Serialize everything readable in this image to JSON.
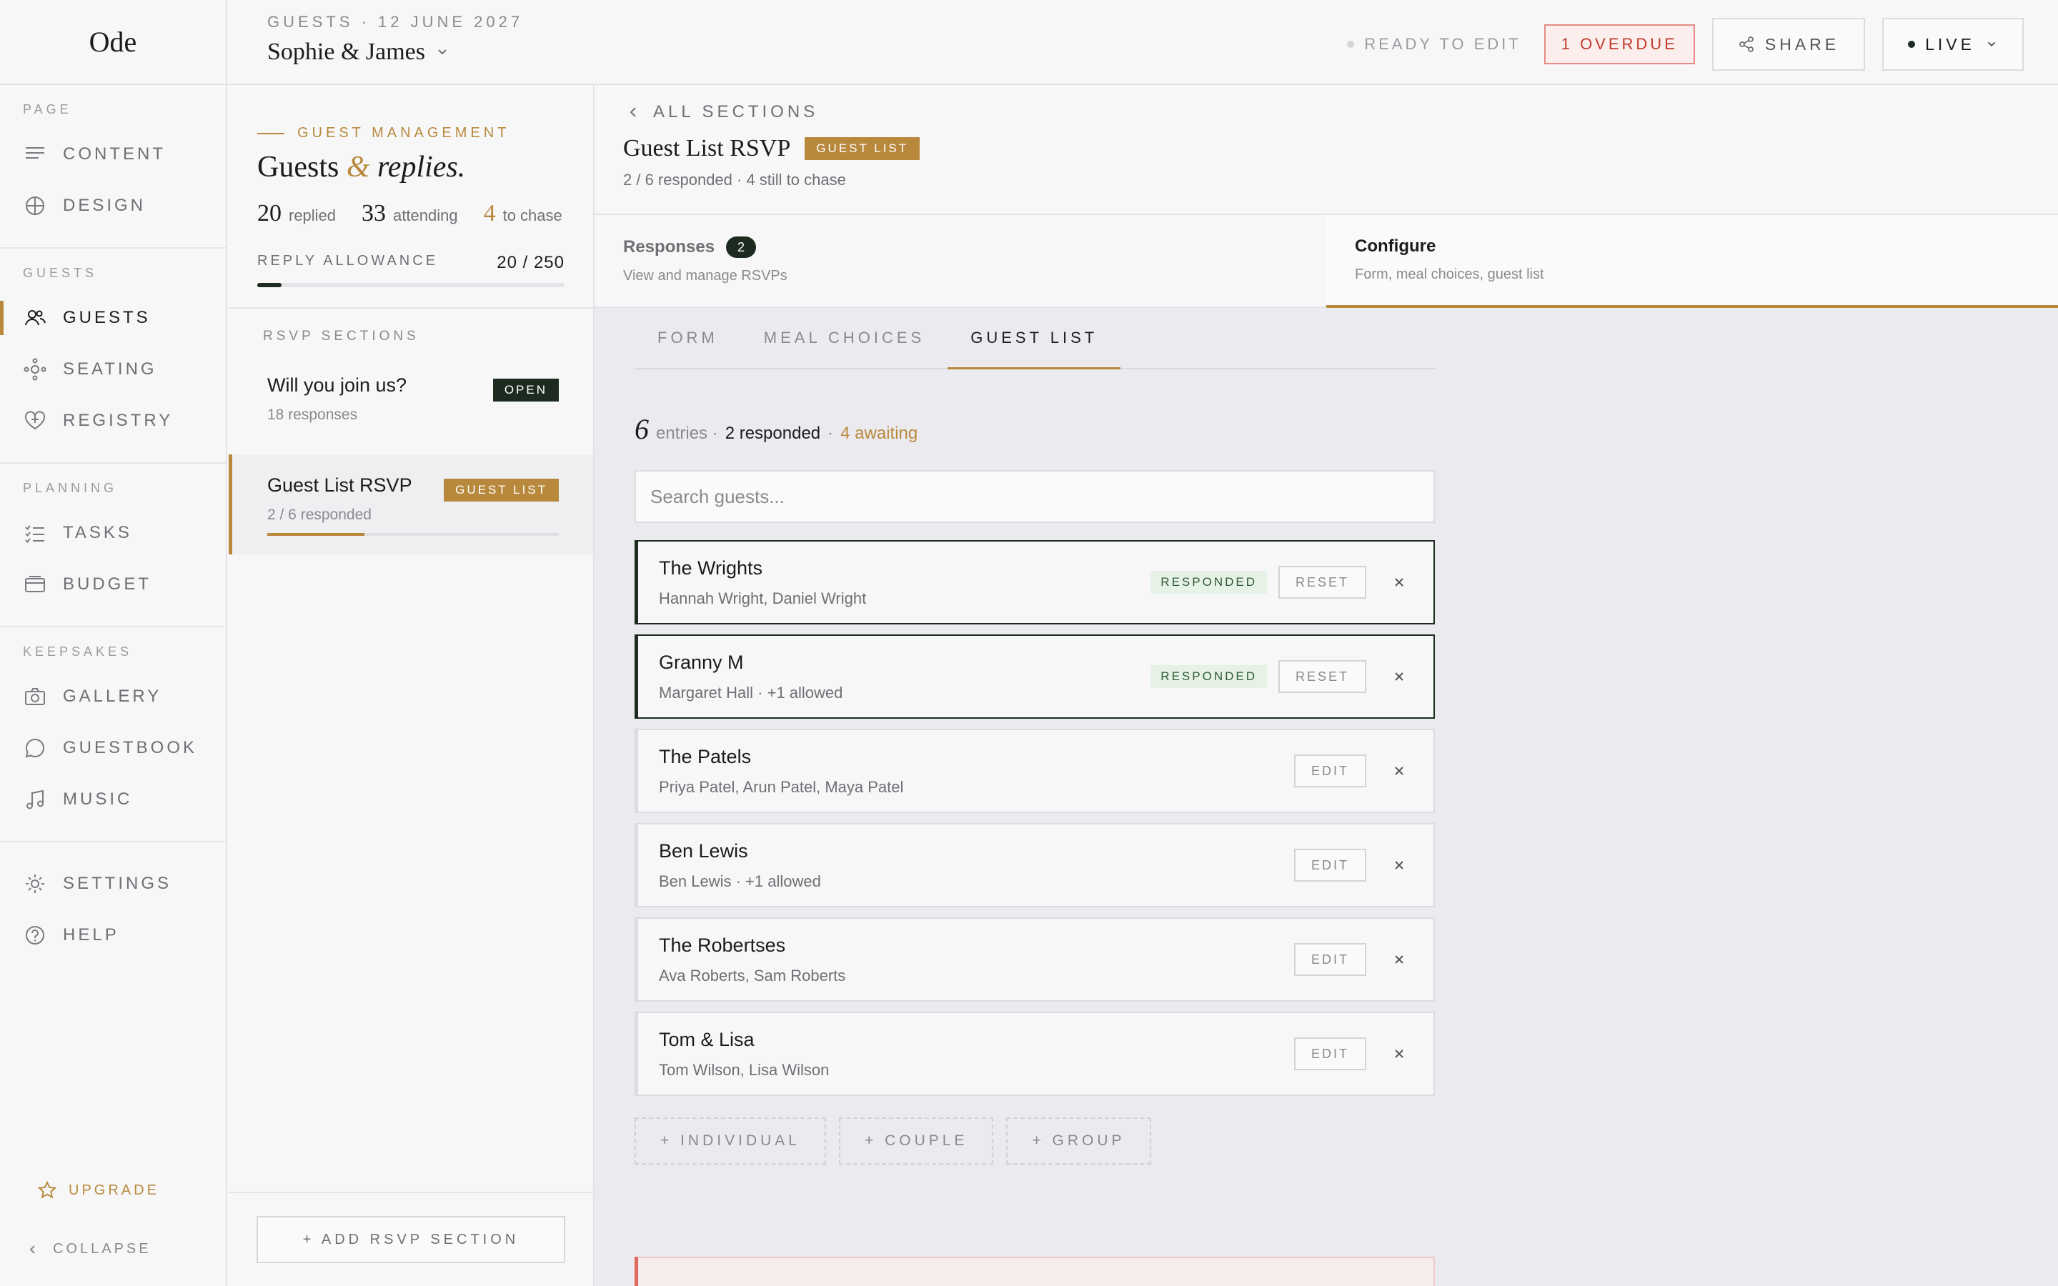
{
  "app": {
    "logo": "Ode"
  },
  "header": {
    "event_line": "GUESTS · 12 JUNE 2027",
    "couple_name": "Sophie & James",
    "status_label": "READY TO EDIT",
    "overdue_label": "1 OVERDUE",
    "share_label": "SHARE",
    "live_label": "LIVE"
  },
  "nav": {
    "sections": [
      {
        "title": "PAGE",
        "items": [
          {
            "label": "CONTENT",
            "icon": "lines-icon"
          },
          {
            "label": "DESIGN",
            "icon": "globe-icon"
          }
        ]
      },
      {
        "title": "GUESTS",
        "items": [
          {
            "label": "GUESTS",
            "icon": "people-icon",
            "active": true
          },
          {
            "label": "SEATING",
            "icon": "seating-icon"
          },
          {
            "label": "REGISTRY",
            "icon": "heart-icon"
          }
        ]
      },
      {
        "title": "PLANNING",
        "items": [
          {
            "label": "TASKS",
            "icon": "checklist-icon"
          },
          {
            "label": "BUDGET",
            "icon": "wallet-icon"
          }
        ]
      },
      {
        "title": "KEEPSAKES",
        "items": [
          {
            "label": "GALLERY",
            "icon": "camera-icon"
          },
          {
            "label": "GUESTBOOK",
            "icon": "chat-icon"
          },
          {
            "label": "MUSIC",
            "icon": "music-icon"
          }
        ]
      }
    ],
    "bottom_items": [
      {
        "label": "SETTINGS",
        "icon": "sun-icon"
      },
      {
        "label": "HELP",
        "icon": "help-icon"
      }
    ],
    "upgrade_label": "UPGRADE",
    "collapse_label": "COLLAPSE"
  },
  "panel": {
    "eyebrow": "GUEST MANAGEMENT",
    "title_part1": "Guests",
    "title_amp": "&",
    "title_part2": "replies.",
    "stats": [
      {
        "value": "20",
        "label": "replied",
        "accent": false
      },
      {
        "value": "33",
        "label": "attending",
        "accent": false
      },
      {
        "value": "4",
        "label": "to chase",
        "accent": true
      }
    ],
    "allowance_label": "REPLY ALLOWANCE",
    "allowance_value": "20 / 250",
    "allowance_fraction": 0.08,
    "rsvp_sections_title": "RSVP SECTIONS",
    "rsvp_sections": [
      {
        "name": "Will you join us?",
        "sub": "18 responses",
        "tag": "OPEN",
        "active": false
      },
      {
        "name": "Guest List RSVP",
        "sub": "2 / 6 responded",
        "tag": "GUEST LIST",
        "active": true,
        "progress": 0.333
      }
    ],
    "add_section_label": "+ ADD RSVP SECTION"
  },
  "main": {
    "back_label": "ALL SECTIONS",
    "title": "Guest List RSVP",
    "title_tag": "GUEST LIST",
    "subtitle": "2 / 6 responded · 4 still to chase",
    "tabs": [
      {
        "label": "Responses",
        "count": "2",
        "desc": "View and manage RSVPs",
        "active": false
      },
      {
        "label": "Configure",
        "desc": "Form, meal choices, guest list",
        "active": true
      }
    ],
    "subtabs": [
      {
        "label": "FORM",
        "active": false
      },
      {
        "label": "MEAL CHOICES",
        "active": false
      },
      {
        "label": "GUEST LIST",
        "active": true
      }
    ],
    "summary": {
      "count": "6",
      "entries": "entries ·",
      "responded": "2 responded",
      "sep": "·",
      "awaiting": "4 awaiting"
    },
    "search_placeholder": "Search guests...",
    "guests": [
      {
        "name": "The Wrights",
        "members": "Hannah Wright, Daniel Wright",
        "responded": true,
        "badge": "RESPONDED",
        "action": "RESET"
      },
      {
        "name": "Granny M",
        "members": "Margaret Hall · +1 allowed",
        "responded": true,
        "badge": "RESPONDED",
        "action": "RESET"
      },
      {
        "name": "The Patels",
        "members": "Priya Patel, Arun Patel, Maya Patel",
        "responded": false,
        "action": "EDIT"
      },
      {
        "name": "Ben Lewis",
        "members": "Ben Lewis · +1 allowed",
        "responded": false,
        "action": "EDIT"
      },
      {
        "name": "The Robertses",
        "members": "Ava Roberts, Sam Roberts",
        "responded": false,
        "action": "EDIT"
      },
      {
        "name": "Tom & Lisa",
        "members": "Tom Wilson, Lisa Wilson",
        "responded": false,
        "action": "EDIT"
      }
    ],
    "add_buttons": [
      "+ INDIVIDUAL",
      "+ COUPLE",
      "+ GROUP"
    ]
  },
  "colors": {
    "accent": "#b8893d",
    "dark": "#1c2a1f",
    "danger": "#c0392b"
  }
}
